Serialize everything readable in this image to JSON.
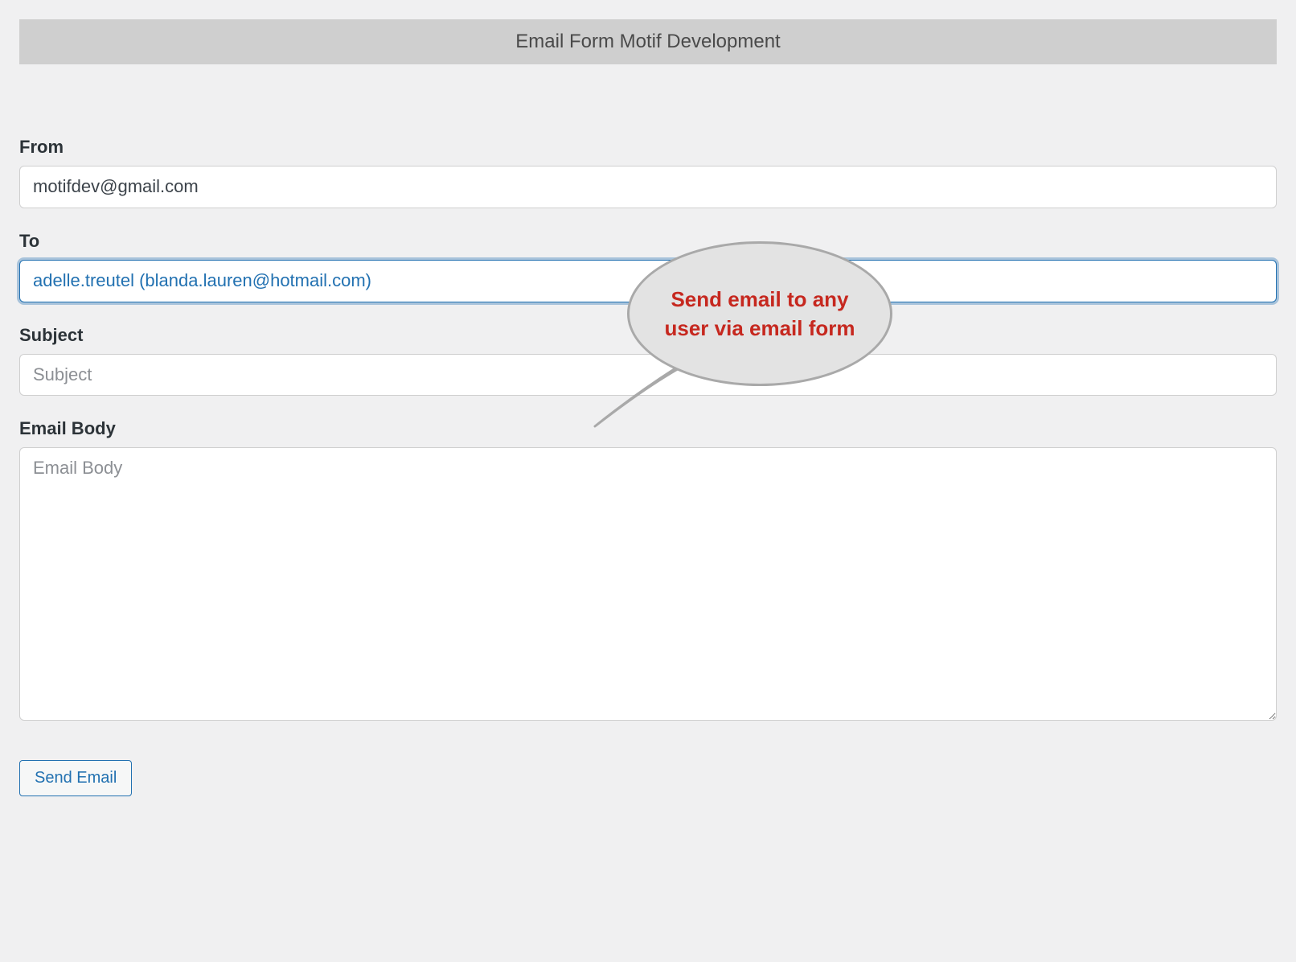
{
  "header": {
    "title": "Email Form Motif Development"
  },
  "form": {
    "from_label": "From",
    "from_value": "motifdev@gmail.com",
    "to_label": "To",
    "to_value": "adelle.treutel (blanda.lauren@hotmail.com)",
    "subject_label": "Subject",
    "subject_value": "",
    "subject_placeholder": "Subject",
    "body_label": "Email Body",
    "body_value": "",
    "body_placeholder": "Email Body",
    "send_label": "Send Email"
  },
  "callout": {
    "text": "Send email to any user via email form"
  }
}
